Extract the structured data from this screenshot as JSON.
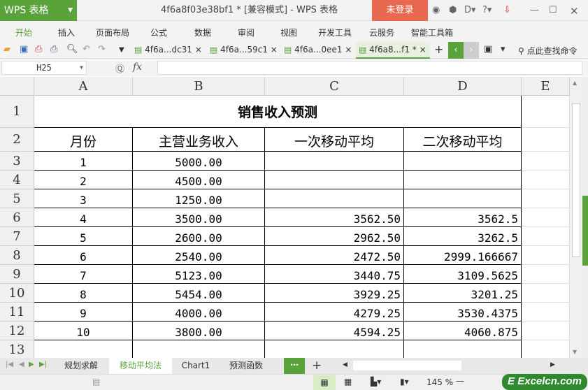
{
  "app": {
    "logo": "WPS 表格",
    "title": "4f6a8f03e38bf1 * [兼容模式] - WPS 表格",
    "login": "未登录"
  },
  "menu": [
    "开始",
    "插入",
    "页面布局",
    "公式",
    "数据",
    "审阅",
    "视图",
    "开发工具",
    "云服务",
    "智能工具箱"
  ],
  "doc_tabs": [
    "4f6a...dc31",
    "4f6a...59c1",
    "4f6a...0ee1",
    "4f6a8...f1 *"
  ],
  "search_cmd": "点此查找命令",
  "formula": {
    "namebox": "H25",
    "fx": "fx",
    "value": ""
  },
  "columns": [
    "A",
    "B",
    "C",
    "D",
    "E"
  ],
  "rows": [
    "1",
    "2",
    "3",
    "4",
    "5",
    "6",
    "7",
    "8",
    "9",
    "10",
    "11",
    "12",
    "13"
  ],
  "table": {
    "title": "销售收入预测",
    "headers": [
      "月份",
      "主营业务收入",
      "一次移动平均",
      "二次移动平均"
    ],
    "data": [
      [
        "1",
        "5000.00",
        "",
        ""
      ],
      [
        "2",
        "4500.00",
        "",
        ""
      ],
      [
        "3",
        "1250.00",
        "",
        ""
      ],
      [
        "4",
        "3500.00",
        "3562.50",
        "3562.5"
      ],
      [
        "5",
        "2600.00",
        "2962.50",
        "3262.5"
      ],
      [
        "6",
        "2540.00",
        "2472.50",
        "2999.166667"
      ],
      [
        "7",
        "5123.00",
        "3440.75",
        "3109.5625"
      ],
      [
        "8",
        "5454.00",
        "3929.25",
        "3201.25"
      ],
      [
        "9",
        "4000.00",
        "4279.25",
        "3530.4375"
      ],
      [
        "10",
        "3800.00",
        "4594.25",
        "4060.875"
      ]
    ]
  },
  "sheets": [
    "规划求解",
    "移动平均法",
    "Chart1",
    "预测函数"
  ],
  "active_sheet": 1,
  "zoom": "145 %",
  "watermark": "Excelcn.com",
  "colors": {
    "accent": "#5aa33a",
    "login": "#e8694f"
  }
}
